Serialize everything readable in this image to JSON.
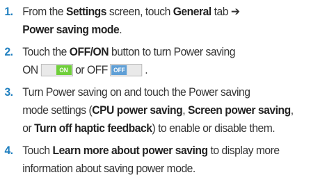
{
  "steps": [
    {
      "number": "1.",
      "t1": "From the ",
      "b1": "Settings",
      "t2": " screen, touch ",
      "b2": "General",
      "t3": " tab ➔",
      "b3": "Power saving mode",
      "t4": "."
    },
    {
      "number": "2.",
      "t1": "Touch the ",
      "b1": "OFF/ON",
      "t2": " button to turn Power saving",
      "t3": "ON",
      "toggle_on_text": "ON",
      "t4": "or OFF",
      "toggle_off_text": "OFF",
      "t5": "."
    },
    {
      "number": "3.",
      "t1": "Turn Power saving on and touch the Power saving",
      "t2": "mode settings (",
      "b1": "CPU power saving",
      "t3": ", ",
      "b2": "Screen power saving",
      "t4": ",",
      "t5": "or ",
      "b3": "Turn off haptic feedback",
      "t6": ") to enable or disable them."
    },
    {
      "number": "4.",
      "t1": "Touch ",
      "b1": "Learn more about power saving",
      "t2": " to display more",
      "t3": "information about saving power mode."
    }
  ],
  "colors": {
    "step_number": "#1f7fbf",
    "toggle_on": "#6fcf3a",
    "toggle_off": "#5f9fd6"
  }
}
